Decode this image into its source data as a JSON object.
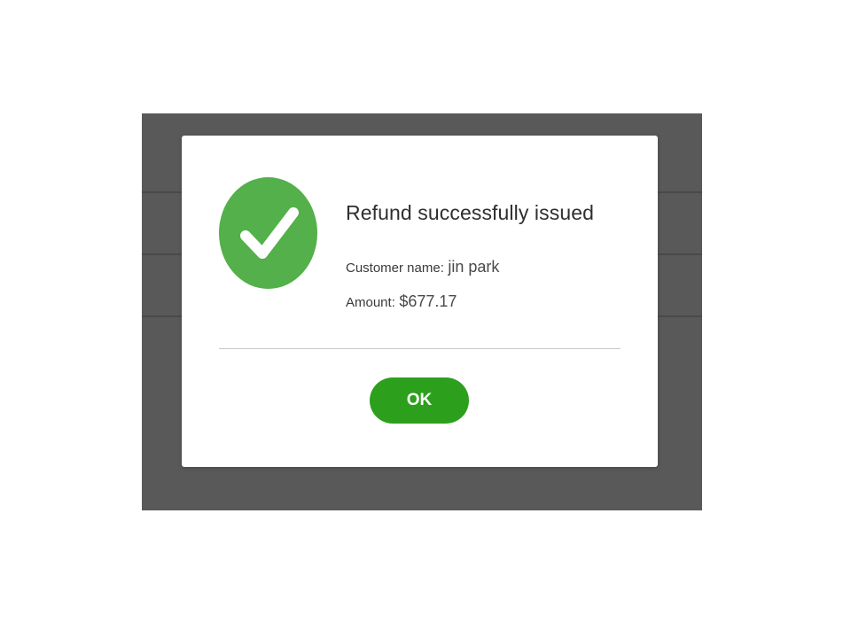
{
  "dialog": {
    "title": "Refund successfully issued",
    "customer_label": "Customer name:",
    "customer_value": "jin park",
    "amount_label": "Amount:",
    "amount_value": "$677.17",
    "ok_label": "OK",
    "icon": "check-circle-icon"
  },
  "colors": {
    "backdrop": "#595959",
    "success_green": "#53b04a",
    "button_green": "#2ca01c",
    "divider": "#c8c8c8"
  }
}
